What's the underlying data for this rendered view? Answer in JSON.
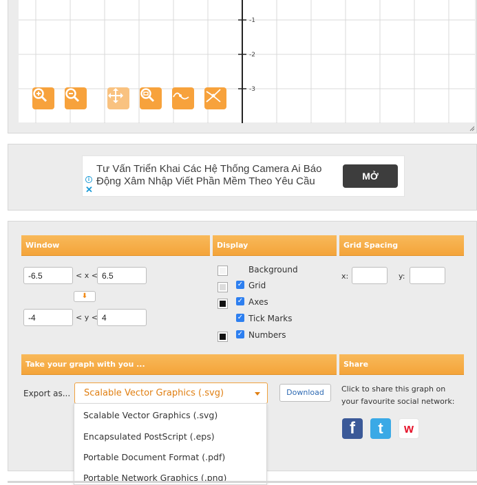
{
  "graph": {
    "axis_ticks": [
      "-1",
      "-2",
      "-3"
    ],
    "tools": [
      {
        "name": "zoom-in-icon"
      },
      {
        "name": "zoom-out-icon"
      },
      {
        "name": "move-icon"
      },
      {
        "name": "zoom-fit-icon"
      },
      {
        "name": "curve-trace-icon"
      },
      {
        "name": "intersect-icon"
      }
    ]
  },
  "ad": {
    "text": "Tư Vấn Triển Khai Các Hệ Thống Camera Ai Báo Động Xâm Nhập Viết Phần Mềm Theo Yêu Cầu",
    "button": "MỞ",
    "info_icon": "i",
    "close_icon": "✕"
  },
  "window": {
    "title": "Window",
    "x_min": "-6.5",
    "x_max": "6.5",
    "x_relation": "< x <",
    "y_min": "-4",
    "y_max": "4",
    "y_relation": "< y <",
    "swap_icon": "⬇"
  },
  "display": {
    "title": "Display",
    "options": [
      {
        "label": "Background",
        "checked": false,
        "swatch": "#f4f4f4"
      },
      {
        "label": "Grid",
        "checked": true,
        "swatch": "#dcdcdc"
      },
      {
        "label": "Axes",
        "checked": true,
        "swatch": "#111111"
      },
      {
        "label": "Tick Marks",
        "checked": true,
        "swatch": null
      },
      {
        "label": "Numbers",
        "checked": true,
        "swatch": "#111111"
      }
    ],
    "check_mark": "✓"
  },
  "grid_spacing": {
    "title": "Grid Spacing",
    "x_label": "x:",
    "x_value": "",
    "y_label": "y:",
    "y_value": ""
  },
  "export": {
    "title": "Take your graph with you ...",
    "label": "Export as...",
    "selected": "Scalable Vector Graphics (.svg)",
    "download": "Download",
    "options": [
      "Scalable Vector Graphics (.svg)",
      "Encapsulated PostScript (.eps)",
      "Portable Document Format (.pdf)",
      "Portable Network Graphics (.png)"
    ]
  },
  "share": {
    "title": "Share",
    "text": "Click to share this graph on your favourite social network:",
    "networks": [
      {
        "name": "facebook",
        "glyph": "f",
        "color": "#3b5998"
      },
      {
        "name": "twitter",
        "glyph": "t",
        "color": "#3aa9e6"
      },
      {
        "name": "weibo",
        "glyph": "w",
        "color": "#e6162d"
      }
    ]
  }
}
